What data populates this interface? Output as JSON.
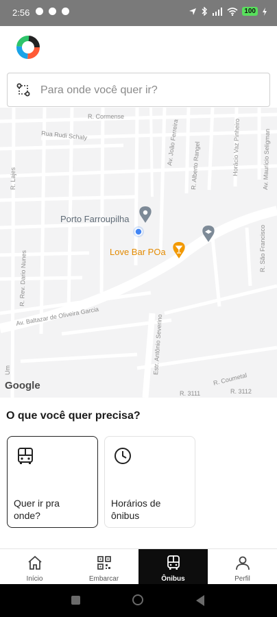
{
  "status_bar": {
    "time": "2:56",
    "battery": "100"
  },
  "search": {
    "placeholder": "Para onde você quer ir?"
  },
  "map": {
    "streets": {
      "r_cormense": "R. Cormense",
      "rua_rudi_schaly": "Rua Rudi Schaly",
      "av_joao_ferreira": "Av. João Ferreira",
      "r_alberto_rangel": "R. Alberto Rangel",
      "horacio_vaz_pinheiro": "Horácio Vaz Pinheiro",
      "av_mauricio_seligman": "Av. Maurício Seligman",
      "r_lajes": "R. Lajes",
      "r_rev_daniel_nunes": "R. Rev. Dario Nunes",
      "av_baltazar": "Av. Baltazar de Oliveira Garcia",
      "r_sao_francisco": "R. São Francisco",
      "estr_antonio_severino": "Estr. Antônio Severino",
      "r_coumetal": "R. Coumetal",
      "r_3111": "R. 3111",
      "r_3112": "R. 3112",
      "um": "Um"
    },
    "places": {
      "porto_farroupilha": "Porto Farroupilha",
      "love_bar": "Love Bar POa"
    },
    "attribution": "Google"
  },
  "section": {
    "title": "O que você quer precisa?"
  },
  "cards": [
    {
      "label_line1": "Quer ir pra",
      "label_line2": "onde?"
    },
    {
      "label_line1": "Horários de",
      "label_line2": "ônibus"
    }
  ],
  "bottom_nav": [
    {
      "label": "Início"
    },
    {
      "label": "Embarcar"
    },
    {
      "label": "Ônibus"
    },
    {
      "label": "Perfil"
    }
  ],
  "colors": {
    "accent_active_nav": "#0d0d0d",
    "user_location": "#4285f4",
    "bar_pin": "#f29900"
  }
}
